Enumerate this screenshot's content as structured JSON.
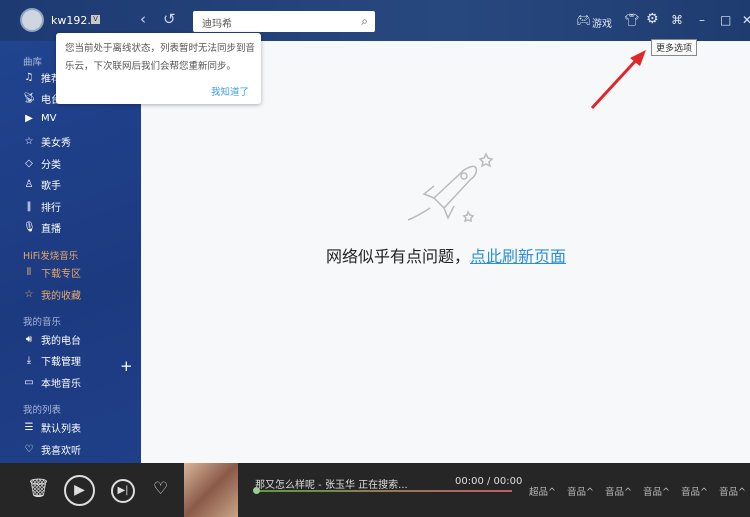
{
  "header": {
    "username": "kw192...",
    "vip_badge": "V",
    "search_value": "迪玛希",
    "game_label": "游戏",
    "tooltip": "更多选项"
  },
  "popup": {
    "message": "您当前处于离线状态，列表暂时无法同步到音乐云，下次联网后我们会帮您重新同步。",
    "confirm": "我知道了"
  },
  "sidebar": {
    "library_title": "曲库",
    "library": [
      {
        "label": "推荐",
        "icon": "music-note-icon"
      },
      {
        "label": "电台",
        "icon": "radio-icon"
      },
      {
        "label": "MV",
        "icon": "video-icon"
      },
      {
        "label": "美女秀",
        "icon": "star-icon"
      },
      {
        "label": "分类",
        "icon": "tag-icon"
      },
      {
        "label": "歌手",
        "icon": "person-icon"
      },
      {
        "label": "排行",
        "icon": "bars-icon"
      },
      {
        "label": "直播",
        "icon": "mic-icon"
      }
    ],
    "hifi_title": "HiFi发烧音乐",
    "hifi": [
      {
        "label": "下载专区",
        "icon": "waveform-icon"
      },
      {
        "label": "我的收藏",
        "icon": "star-icon"
      }
    ],
    "mymusic_title": "我的音乐",
    "mymusic": [
      {
        "label": "我的电台",
        "icon": "speaker-icon"
      },
      {
        "label": "下载管理",
        "icon": "download-icon"
      },
      {
        "label": "本地音乐",
        "icon": "monitor-icon"
      }
    ],
    "lists_title": "我的列表",
    "lists": [
      {
        "label": "默认列表",
        "icon": "list-icon"
      },
      {
        "label": "我喜欢听",
        "icon": "heart-icon"
      }
    ]
  },
  "main": {
    "error_text": "网络似乎有点问题，",
    "refresh_link": "点此刷新页面"
  },
  "player": {
    "song": "那又怎么样呢 - 张玉华 正在搜索...",
    "time": "00:00 / 00:00",
    "progress": 0,
    "qualities": [
      "超品^",
      "音品^",
      "音品^",
      "音品^",
      "音品^",
      "音品^"
    ]
  }
}
